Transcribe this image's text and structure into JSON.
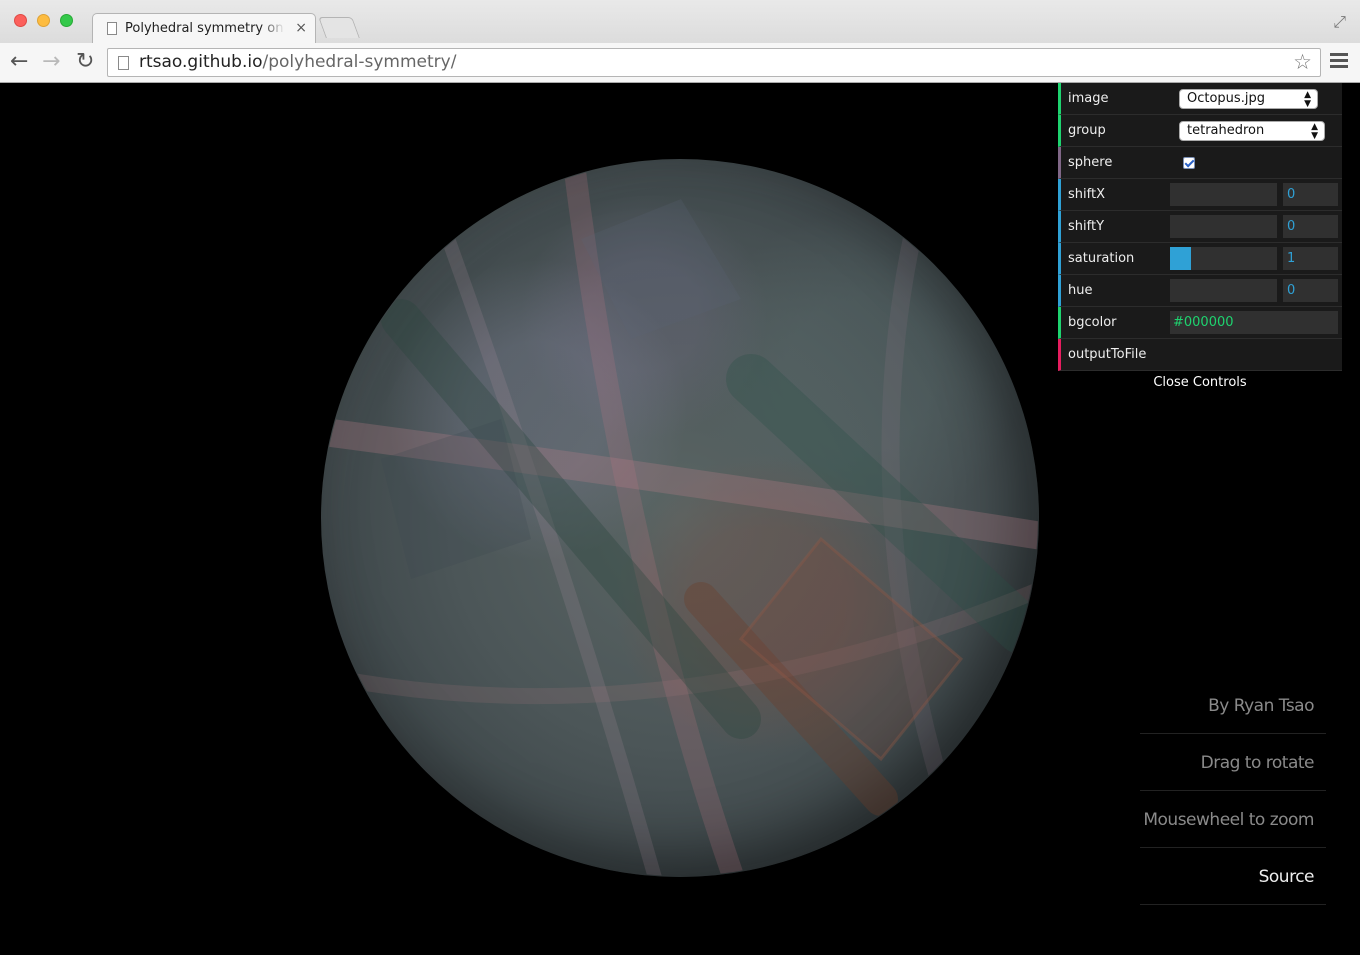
{
  "browser": {
    "tab_title": "Polyhedral symmetry on a sphere",
    "tab_close": "×",
    "url_host": "rtsao.github.io",
    "url_path": "/polyhedral-symmetry/",
    "icons": {
      "back": "back-arrow-icon",
      "forward": "forward-arrow-icon",
      "reload": "reload-icon",
      "bookmark": "star-icon",
      "menu": "hamburger-menu-icon",
      "fullscreen": "fullscreen-icon"
    }
  },
  "controls": {
    "image": {
      "label": "image",
      "value": "Octopus.jpg"
    },
    "group": {
      "label": "group",
      "value": "tetrahedron"
    },
    "sphere": {
      "label": "sphere",
      "checked": true
    },
    "shiftX": {
      "label": "shiftX",
      "value": "0",
      "fraction": 0
    },
    "shiftY": {
      "label": "shiftY",
      "value": "0",
      "fraction": 0
    },
    "saturation": {
      "label": "saturation",
      "value": "1",
      "fraction": 0.2
    },
    "hue": {
      "label": "hue",
      "value": "0",
      "fraction": 0
    },
    "bgcolor": {
      "label": "bgcolor",
      "value": "#000000"
    },
    "outputToFile": {
      "label": "outputToFile"
    },
    "close_label": "Close Controls",
    "accent_colors": {
      "string": "#1ed36f",
      "number": "#2fa1d6",
      "boolean": "#806787",
      "function": "#e61d5f"
    }
  },
  "info_links": {
    "author": "By Ryan Tsao",
    "drag": "Drag to rotate",
    "zoom": "Mousewheel to zoom",
    "source": "Source"
  }
}
